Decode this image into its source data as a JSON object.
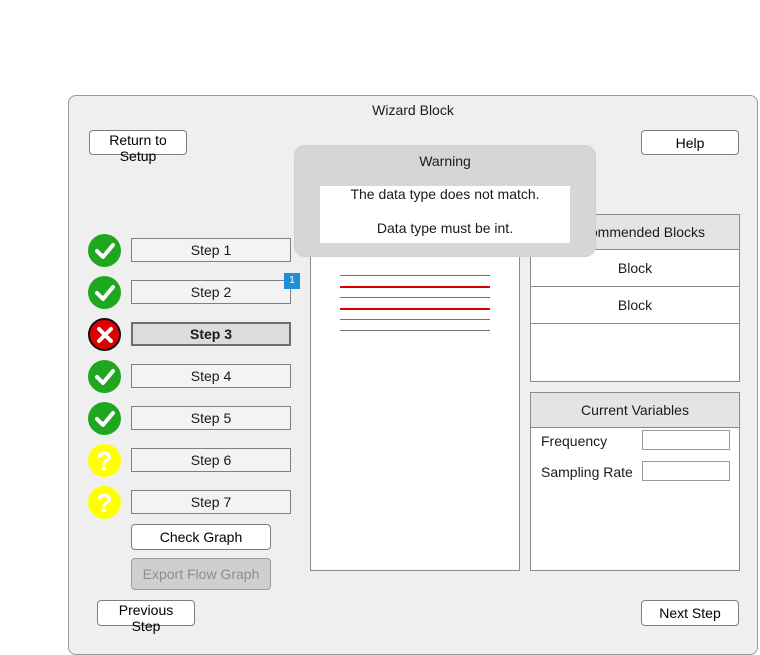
{
  "window": {
    "title": "Wizard Block"
  },
  "toolbar": {
    "return_label": "Return to Setup",
    "help_label": "Help"
  },
  "steps": [
    {
      "label": "Step 1",
      "status": "success"
    },
    {
      "label": "Step 2",
      "status": "success",
      "badge": "1"
    },
    {
      "label": "Step 3",
      "status": "error",
      "active": true
    },
    {
      "label": "Step 4",
      "status": "success"
    },
    {
      "label": "Step 5",
      "status": "success"
    },
    {
      "label": "Step 6",
      "status": "unknown"
    },
    {
      "label": "Step 7",
      "status": "unknown"
    }
  ],
  "actions": {
    "check_graph": "Check Graph",
    "export_flow_graph": "Export Flow Graph"
  },
  "nav": {
    "previous": "Previous Step",
    "next": "Next Step"
  },
  "recommended": {
    "title": "Recommended Blocks",
    "items": [
      "Block",
      "Block"
    ]
  },
  "variables": {
    "title": "Current Variables",
    "fields": [
      {
        "label": "Frequency",
        "value": ""
      },
      {
        "label": "Sampling Rate",
        "value": ""
      }
    ]
  },
  "warning": {
    "title": "Warning",
    "line1": "The data type does not match.",
    "line2": "Data type must be int."
  },
  "colors": {
    "success": "#1fa81f",
    "error": "#e00000",
    "unknown": "#ffff00",
    "badge": "#1e90d6",
    "error_line": "#d60000"
  },
  "icons": {
    "success": "check-icon",
    "error": "x-icon",
    "unknown": "question-icon"
  }
}
